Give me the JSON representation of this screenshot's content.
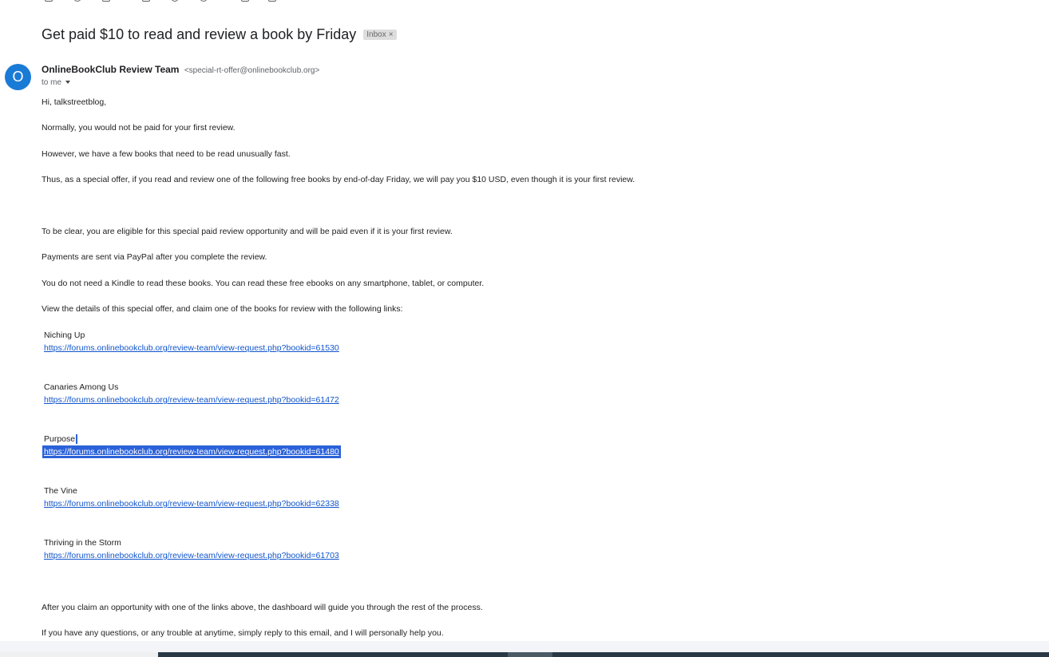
{
  "email": {
    "subject": "Get paid $10 to read and review a book by Friday",
    "label": "Inbox",
    "label_close": "×",
    "avatar_letter": "O",
    "sender_name": "OnlineBookClub Review Team",
    "sender_email": "<special-rt-offer@onlinebookclub.org>",
    "to": "to me"
  },
  "body": {
    "greeting": "Hi, talkstreetblog,",
    "p1": "Normally, you would not be paid for your first review.",
    "p2": "However, we have a few books that need to be read unusually fast.",
    "p3": "Thus, as a special offer, if you read and review one of the following free books by end-of-day Friday, we will pay you $10 USD, even though it is your first review.",
    "p4": "To be clear, you are eligible for this special paid review opportunity and will be paid even if it is your first review.",
    "p5": "Payments are sent via PayPal after you complete the review.",
    "p6": "You do not need a Kindle to read these books. You can read these free ebooks on any smartphone, tablet, or computer.",
    "p7": "View the details of this special offer, and claim one of the books for review with the following links:",
    "p8": "After you claim an opportunity with one of the links above, the dashboard will guide you through the rest of the process.",
    "p9": "If you have any questions, or any trouble at anytime, simply reply to this email, and I will personally help you."
  },
  "books": [
    {
      "title": "Niching Up",
      "url": "https://forums.onlinebookclub.org/review-team/view-request.php?bookid=61530"
    },
    {
      "title": "Canaries Among Us",
      "url": "https://forums.onlinebookclub.org/review-team/view-request.php?bookid=61472"
    },
    {
      "title": "Purpose",
      "url": "https://forums.onlinebookclub.org/review-team/view-request.php?bookid=61480"
    },
    {
      "title": "The Vine",
      "url": "https://forums.onlinebookclub.org/review-team/view-request.php?bookid=62338"
    },
    {
      "title": "Thriving in the Storm",
      "url": "https://forums.onlinebookclub.org/review-team/view-request.php?bookid=61703"
    }
  ],
  "colors": {
    "link": "#1155cc",
    "selection": "#2b62d9",
    "avatar": "#1a7bd6"
  }
}
